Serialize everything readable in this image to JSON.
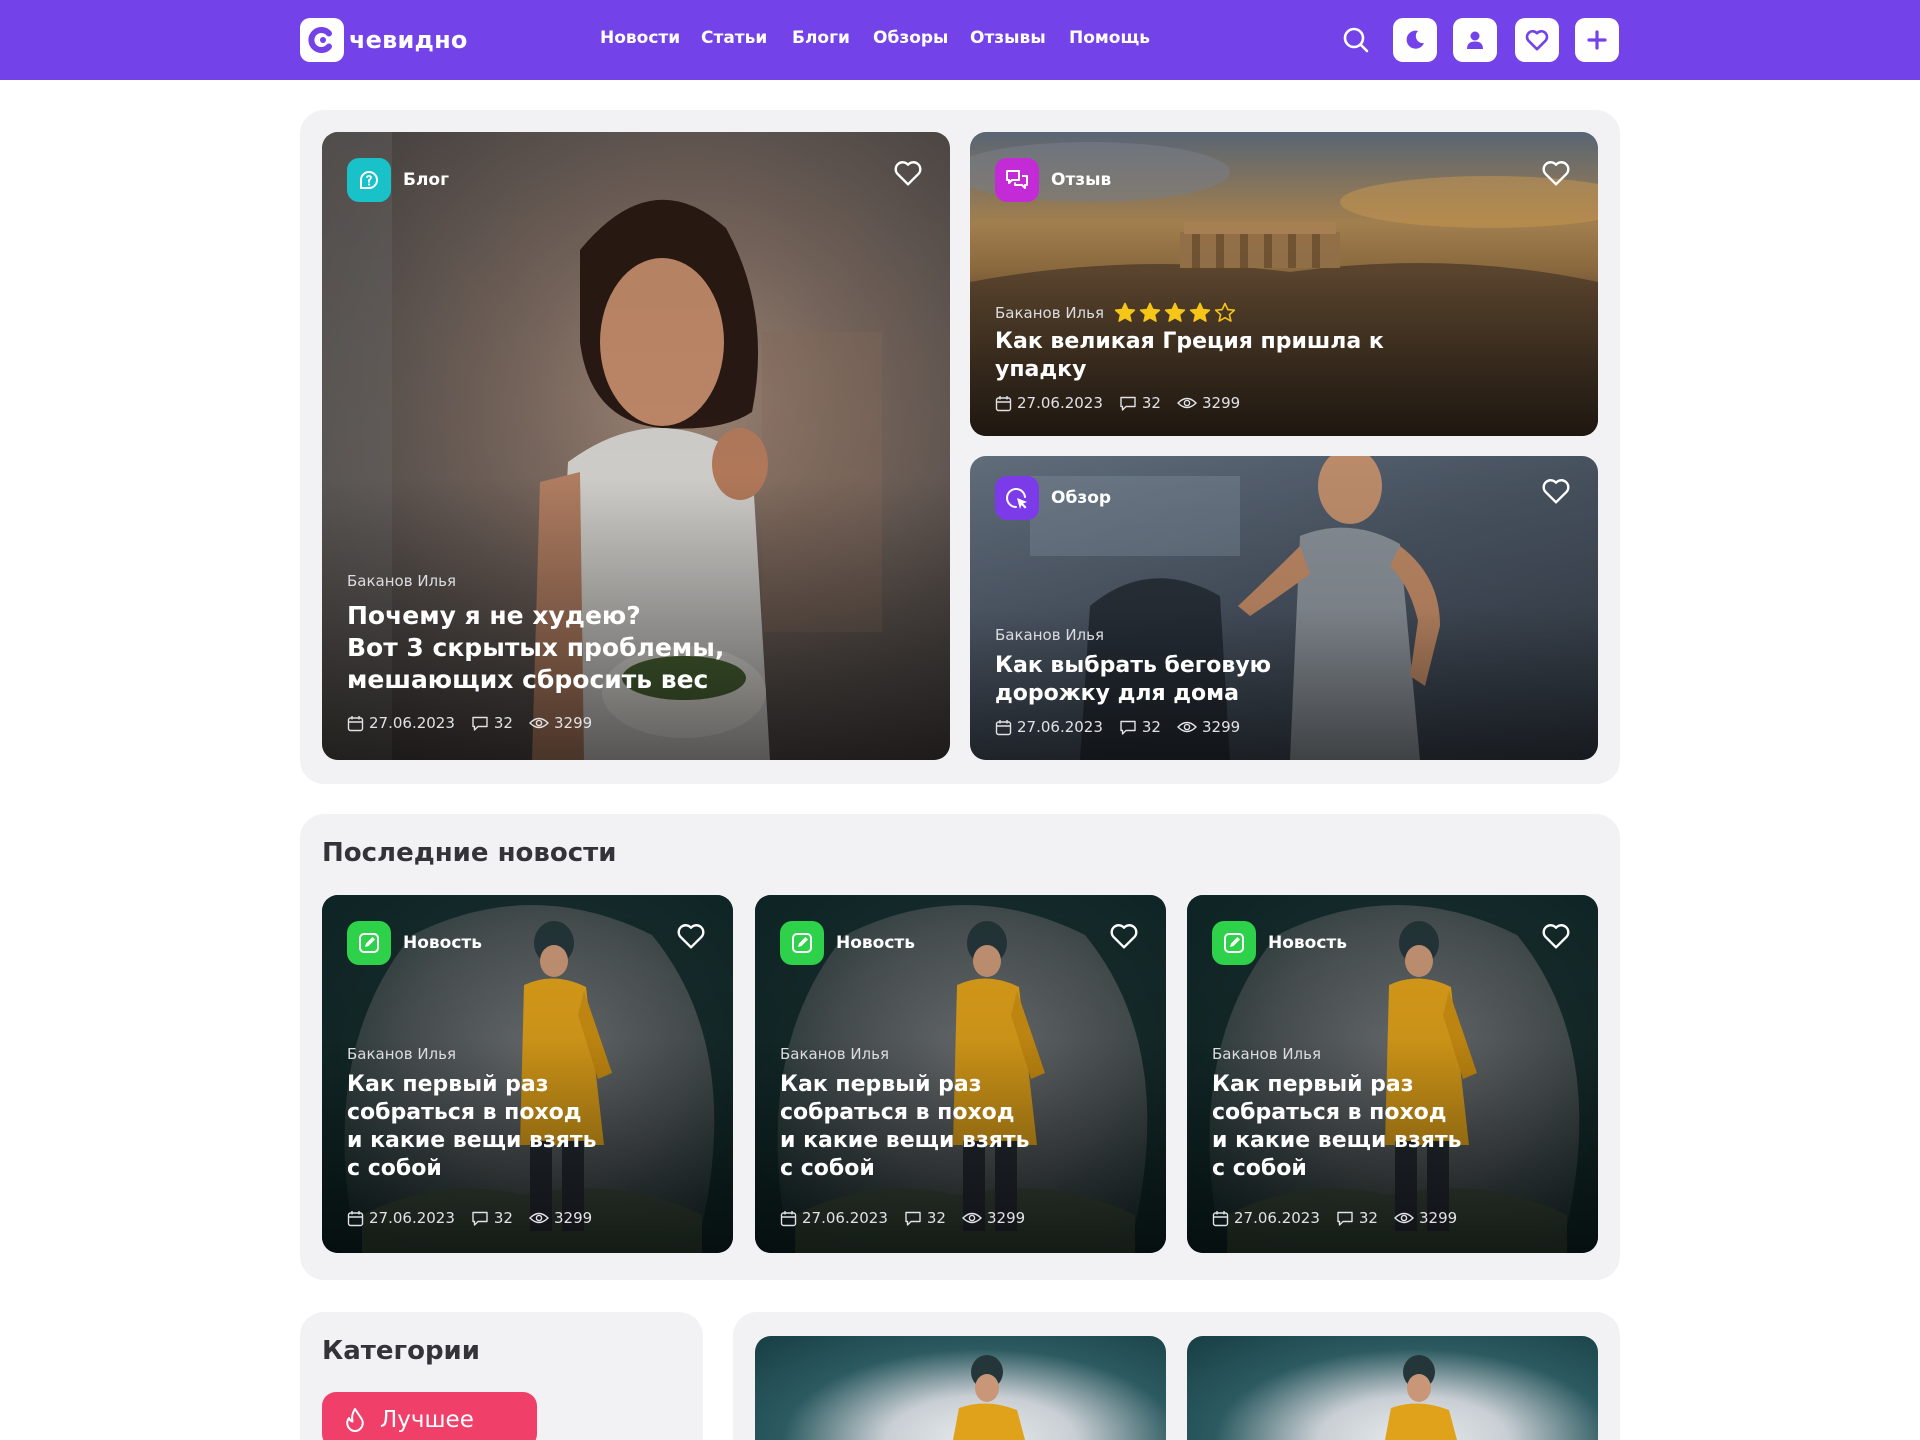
{
  "header": {
    "logo_text": "чевидно",
    "nav": [
      "Новости",
      "Статьи",
      "Блоги",
      "Обзоры",
      "Отзывы",
      "Помощь"
    ],
    "icons": [
      "search-icon",
      "moon-icon",
      "user-icon",
      "heart-icon",
      "plus-icon"
    ]
  },
  "featured": {
    "main": {
      "tag": "Блог",
      "author": "Баканов Илья",
      "title_lines": [
        "Почему я не худею?",
        "Вот 3 скрытых проблемы,",
        "мешающих сбросить вес"
      ],
      "date": "27.06.2023",
      "comments": "32",
      "views": "3299"
    },
    "review": {
      "tag": "Отзыв",
      "author": "Баканов Илья",
      "rating": 4,
      "rating_max": 5,
      "title_lines": [
        "Как великая Греция пришла к",
        "упадку"
      ],
      "date": "27.06.2023",
      "comments": "32",
      "views": "3299"
    },
    "overview": {
      "tag": "Обзор",
      "author": "Баканов Илья",
      "title_lines": [
        "Как выбрать беговую",
        "дорожку для дома"
      ],
      "date": "27.06.2023",
      "comments": "32",
      "views": "3299"
    }
  },
  "latest": {
    "title": "Последние новости",
    "cards": [
      {
        "tag": "Новость",
        "author": "Баканов Илья",
        "title_lines": [
          "Как первый раз",
          "собраться в поход",
          "и какие вещи взять",
          "с собой"
        ],
        "date": "27.06.2023",
        "comments": "32",
        "views": "3299"
      },
      {
        "tag": "Новость",
        "author": "Баканов Илья",
        "title_lines": [
          "Как первый раз",
          "собраться в поход",
          "и какие вещи взять",
          "с собой"
        ],
        "date": "27.06.2023",
        "comments": "32",
        "views": "3299"
      },
      {
        "tag": "Новость",
        "author": "Баканов Илья",
        "title_lines": [
          "Как первый раз",
          "собраться в поход",
          "и какие вещи взять",
          "с собой"
        ],
        "date": "27.06.2023",
        "comments": "32",
        "views": "3299"
      }
    ]
  },
  "categories": {
    "title": "Категории",
    "first_button": "Лучшее"
  },
  "colors": {
    "brand": "#7342e8",
    "blog_tag": "#19c1c9",
    "review_tag": "#c22bd6",
    "overview_tag": "#7c3be8",
    "news_tag": "#2ed24a",
    "best_button": "#f0406a",
    "star": "#f5c518"
  }
}
